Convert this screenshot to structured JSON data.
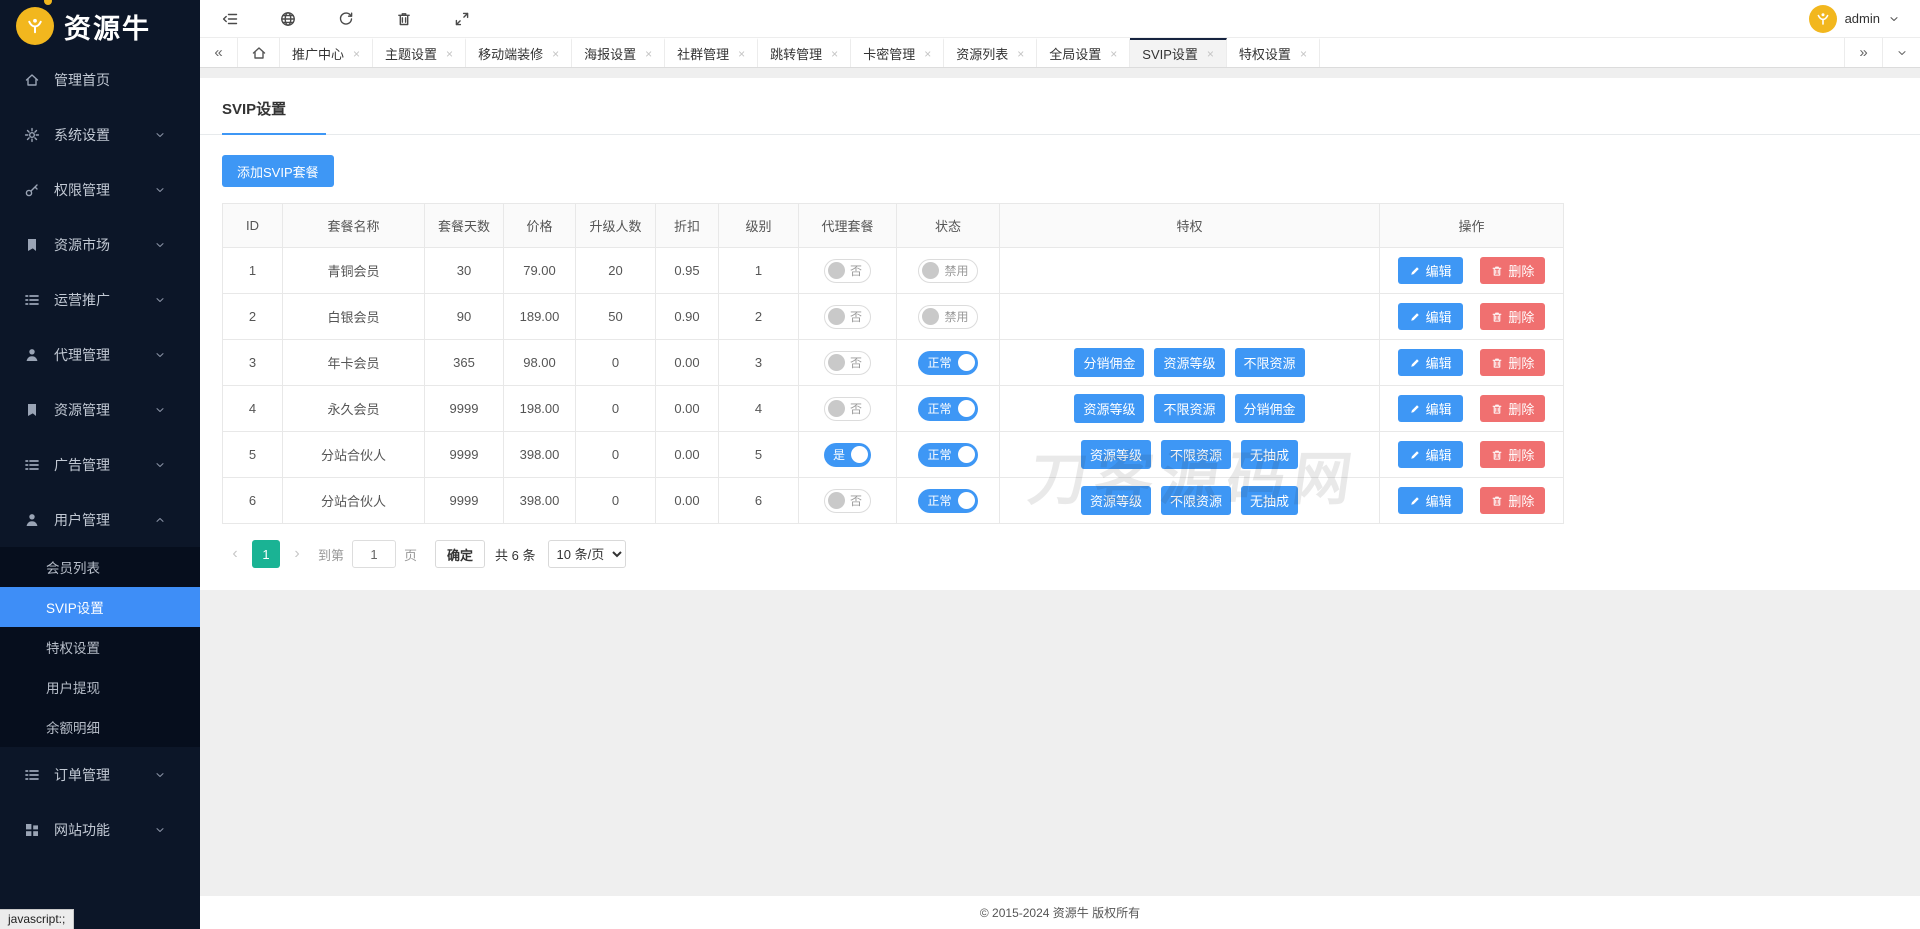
{
  "brand": {
    "name": "资源牛",
    "logo_icon": "bull-logo"
  },
  "topbar": {
    "icons": [
      "sidebar-collapse",
      "globe",
      "refresh",
      "trash",
      "fullscreen"
    ],
    "user": "admin"
  },
  "sidebar": {
    "items": [
      {
        "label": "管理首页",
        "icon": "home"
      },
      {
        "label": "系统设置",
        "icon": "gear",
        "chevron": "down"
      },
      {
        "label": "权限管理",
        "icon": "key",
        "chevron": "down"
      },
      {
        "label": "资源市场",
        "icon": "bag",
        "chevron": "down"
      },
      {
        "label": "运营推广",
        "icon": "list",
        "chevron": "down"
      },
      {
        "label": "代理管理",
        "icon": "agent",
        "chevron": "down"
      },
      {
        "label": "资源管理",
        "icon": "bag",
        "chevron": "down"
      },
      {
        "label": "广告管理",
        "icon": "list",
        "chevron": "down"
      },
      {
        "label": "用户管理",
        "icon": "user",
        "chevron": "up",
        "expanded": true,
        "children": [
          {
            "label": "会员列表",
            "active": false
          },
          {
            "label": "SVIP设置",
            "active": true
          },
          {
            "label": "特权设置",
            "active": false
          },
          {
            "label": "用户提现",
            "active": false
          },
          {
            "label": "余额明细",
            "active": false
          }
        ]
      },
      {
        "label": "订单管理",
        "icon": "list",
        "chevron": "down"
      },
      {
        "label": "网站功能",
        "icon": "grid",
        "chevron": "down"
      }
    ]
  },
  "tabs": {
    "items": [
      {
        "label": "推广中心",
        "active": false
      },
      {
        "label": "主题设置",
        "active": false
      },
      {
        "label": "移动端装修",
        "active": false
      },
      {
        "label": "海报设置",
        "active": false
      },
      {
        "label": "社群管理",
        "active": false
      },
      {
        "label": "跳转管理",
        "active": false
      },
      {
        "label": "卡密管理",
        "active": false
      },
      {
        "label": "资源列表",
        "active": false
      },
      {
        "label": "全局设置",
        "active": false
      },
      {
        "label": "SVIP设置",
        "active": true
      },
      {
        "label": "特权设置",
        "active": false
      }
    ]
  },
  "page": {
    "title": "SVIP设置",
    "add_button": "添加SVIP套餐"
  },
  "table": {
    "columns": [
      "ID",
      "套餐名称",
      "套餐天数",
      "价格",
      "升级人数",
      "折扣",
      "级别",
      "代理套餐",
      "状态",
      "特权",
      "操作"
    ],
    "action_labels": {
      "edit": "编辑",
      "delete": "删除"
    },
    "rows": [
      {
        "id": "1",
        "name": "青铜会员",
        "days": "30",
        "price": "79.00",
        "upgrade": "20",
        "discount": "0.95",
        "level": "1",
        "agent": {
          "on": false,
          "label": "否"
        },
        "status": {
          "on": false,
          "label": "禁用"
        },
        "privileges": []
      },
      {
        "id": "2",
        "name": "白银会员",
        "days": "90",
        "price": "189.00",
        "upgrade": "50",
        "discount": "0.90",
        "level": "2",
        "agent": {
          "on": false,
          "label": "否"
        },
        "status": {
          "on": false,
          "label": "禁用"
        },
        "privileges": []
      },
      {
        "id": "3",
        "name": "年卡会员",
        "days": "365",
        "price": "98.00",
        "upgrade": "0",
        "discount": "0.00",
        "level": "3",
        "agent": {
          "on": false,
          "label": "否"
        },
        "status": {
          "on": true,
          "label": "正常"
        },
        "privileges": [
          "分销佣金",
          "资源等级",
          "不限资源"
        ]
      },
      {
        "id": "4",
        "name": "永久会员",
        "days": "9999",
        "price": "198.00",
        "upgrade": "0",
        "discount": "0.00",
        "level": "4",
        "agent": {
          "on": false,
          "label": "否"
        },
        "status": {
          "on": true,
          "label": "正常"
        },
        "privileges": [
          "资源等级",
          "不限资源",
          "分销佣金"
        ]
      },
      {
        "id": "5",
        "name": "分站合伙人",
        "days": "9999",
        "price": "398.00",
        "upgrade": "0",
        "discount": "0.00",
        "level": "5",
        "agent": {
          "on": true,
          "label": "是"
        },
        "status": {
          "on": true,
          "label": "正常"
        },
        "privileges": [
          "资源等级",
          "不限资源",
          "无抽成"
        ]
      },
      {
        "id": "6",
        "name": "分站合伙人",
        "days": "9999",
        "price": "398.00",
        "upgrade": "0",
        "discount": "0.00",
        "level": "6",
        "agent": {
          "on": false,
          "label": "否"
        },
        "status": {
          "on": true,
          "label": "正常"
        },
        "privileges": [
          "资源等级",
          "不限资源",
          "无抽成"
        ]
      }
    ]
  },
  "pagination": {
    "page": "1",
    "jump_label": "到第",
    "jump_value": "1",
    "jump_unit": "页",
    "confirm": "确定",
    "total": "共 6 条",
    "page_size": "10 条/页"
  },
  "footer": {
    "copyright": "© 2015-2024 资源牛 版权所有"
  },
  "watermark": "刀客源码网",
  "status_tooltip": "javascript:;",
  "colors": {
    "accent": "#3e97f5",
    "danger": "#f07070",
    "pager_active": "#1ab394",
    "sidebar_bg": "#0c1628",
    "sidebar_active": "#3e8ef7",
    "logo_yellow": "#f2b71e"
  }
}
